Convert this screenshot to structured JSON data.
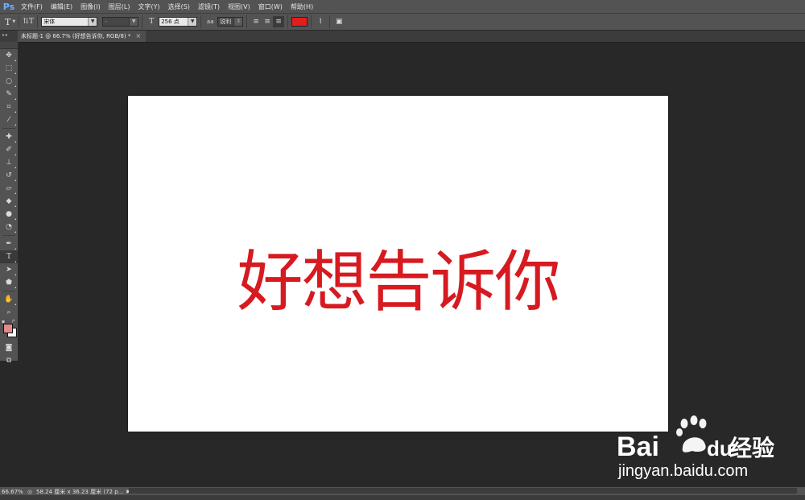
{
  "app": {
    "logo": "Ps"
  },
  "menu": [
    "文件(F)",
    "编辑(E)",
    "图像(I)",
    "图层(L)",
    "文字(Y)",
    "选择(S)",
    "滤镜(T)",
    "视图(V)",
    "窗口(W)",
    "帮助(H)"
  ],
  "options": {
    "font_family": "宋体",
    "font_style": "-",
    "font_size": "256 点",
    "antialias_icon_text": "aa",
    "antialias": "锐利",
    "text_color": "#e11e1e"
  },
  "tab": {
    "title": "未标题-1 @ 66.7% (好想告诉你, RGB/8) *",
    "close": "×"
  },
  "canvas": {
    "text": "好想告诉你",
    "text_color": "#d71920",
    "background": "#ffffff"
  },
  "swatches": {
    "foreground": "#e38a8a",
    "background": "#ffffff"
  },
  "status": {
    "zoom": "66.67%",
    "doc_info": "58.24 厘米 x 36.23 厘米 (72 p...",
    "arrow": "▶"
  },
  "watermark": {
    "brand": "Bai",
    "brand2": "du",
    "product": "经验",
    "url": "jingyan.baidu.com"
  }
}
